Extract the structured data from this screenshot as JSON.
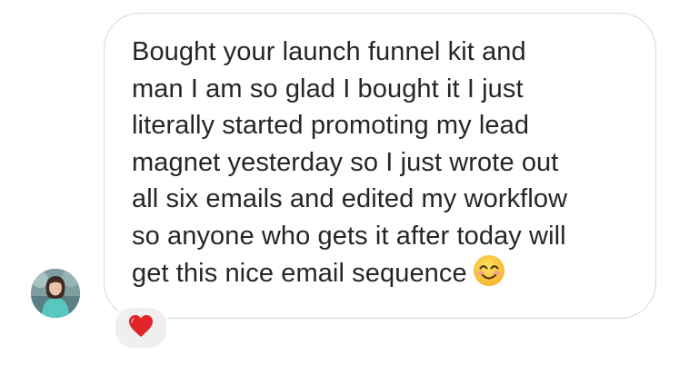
{
  "conversation": {
    "message": {
      "lines": [
        "Bought your launch funnel kit and",
        "man I am so glad I bought it I just",
        "literally started promoting my lead",
        "magnet yesterday so I just wrote out",
        "all six emails and edited my workflow",
        "so anyone who gets it after today will",
        "get this nice email sequence"
      ],
      "trailing_emoji": "smiling-face-with-smiling-eyes-icon"
    },
    "reaction": {
      "icon": "red-heart-icon",
      "color": "#e0242a"
    },
    "colors": {
      "bubble_border": "#d8d8d8",
      "text": "#262626",
      "reaction_bg": "#efefef"
    }
  }
}
